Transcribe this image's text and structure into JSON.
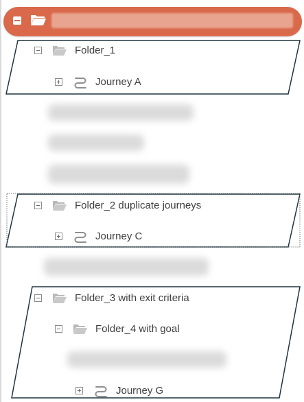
{
  "tree": {
    "root": {
      "icon": "folder-open-icon",
      "expander_icon": "minus-square-icon",
      "label_obscured": true
    },
    "folder_1": {
      "label": "Folder_1",
      "icon": "folder-open-icon",
      "children": [
        {
          "label": "Journey A",
          "icon": "journey-icon",
          "expander": "plus"
        }
      ]
    },
    "folder_2": {
      "label": "Folder_2 duplicate journeys",
      "icon": "folder-open-icon",
      "children": [
        {
          "label": "Journey C",
          "icon": "journey-icon",
          "expander": "plus"
        }
      ]
    },
    "folder_3": {
      "label": "Folder_3 with exit criteria",
      "icon": "folder-open-icon",
      "folder_4": {
        "label": "Folder_4 with goal",
        "icon": "folder-open-icon",
        "children": [
          {
            "label": "Journey G",
            "icon": "journey-icon",
            "expander": "plus"
          }
        ]
      }
    }
  },
  "colors": {
    "root_pill": "#d9694a",
    "frame_stroke": "#1f3540",
    "folder_icon": "#b9b9b9",
    "journey_icon": "#8f8f8f",
    "text": "#3e3e3e"
  }
}
